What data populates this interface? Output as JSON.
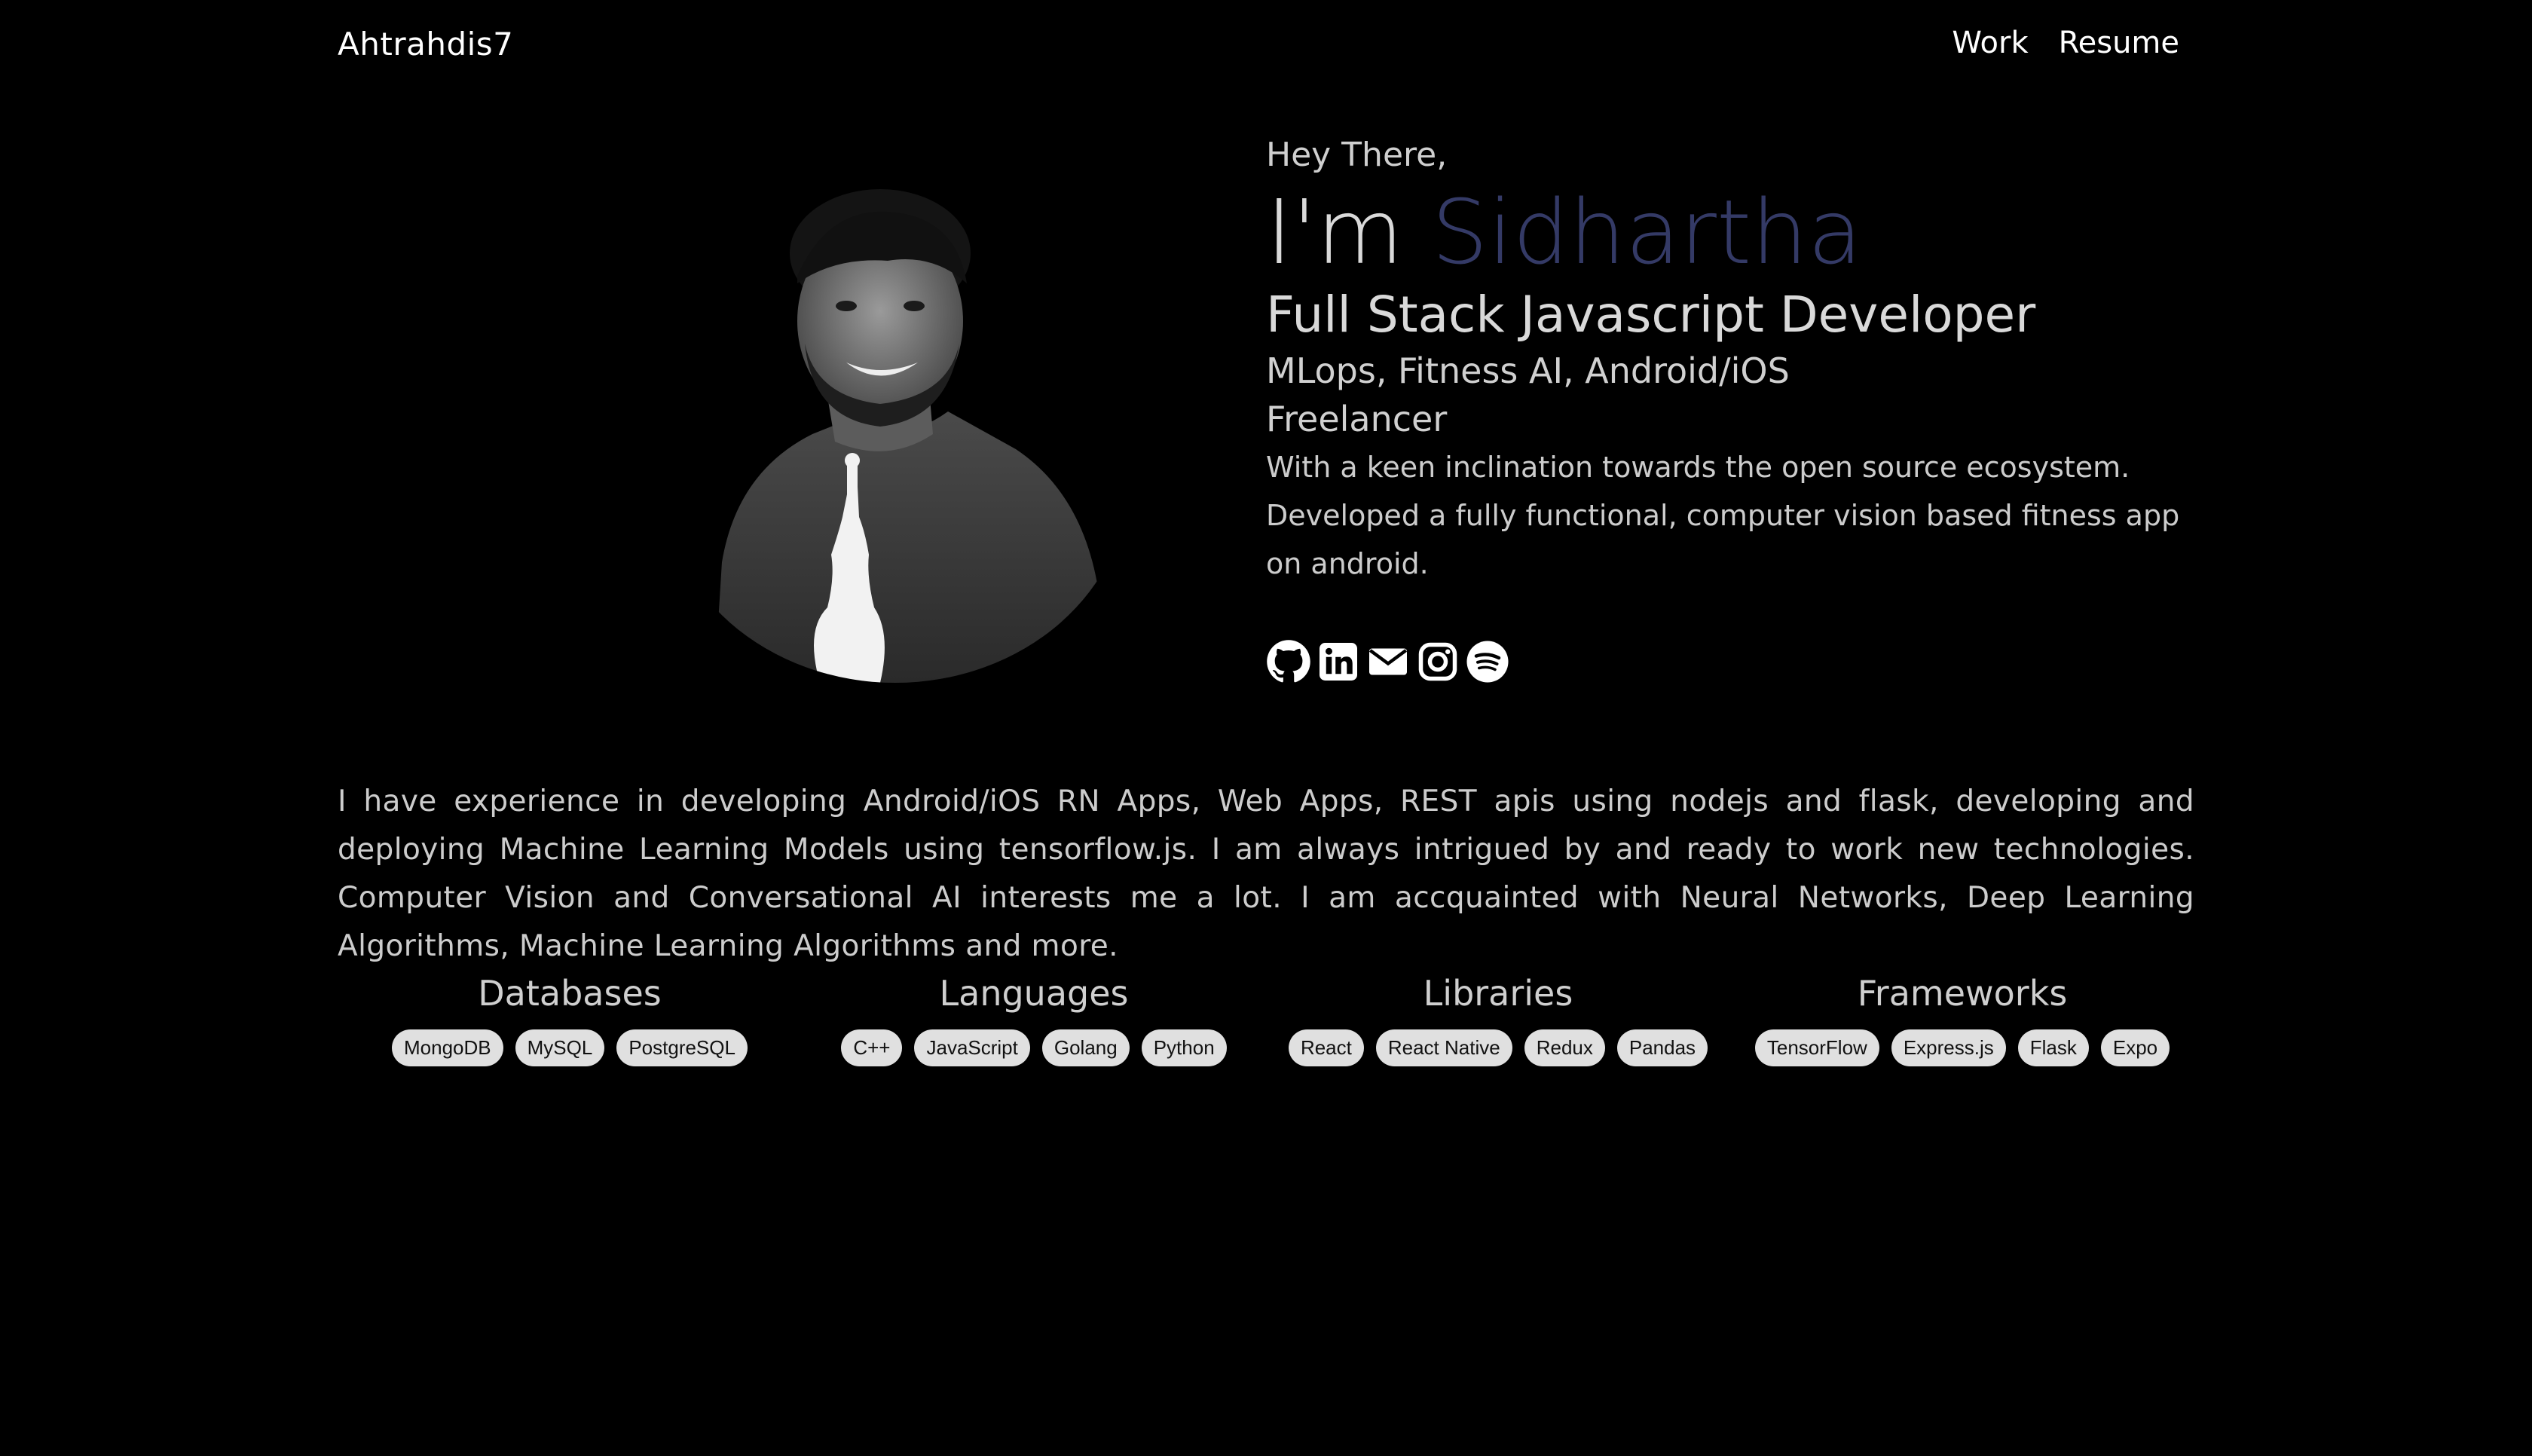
{
  "nav": {
    "brand": "Ahtrahdis7",
    "links": [
      "Work",
      "Resume"
    ]
  },
  "intro": {
    "greeting": "Hey There,",
    "im": "I'm",
    "name": "Sidhartha",
    "role": "Full Stack Javascript Developer",
    "specialties": "MLops, Fitness AI, Android/iOS",
    "status": "Freelancer",
    "description": "With a keen inclination towards the open source ecosystem. Developed a fully functional, computer vision based fitness app on android."
  },
  "socials": [
    "github-icon",
    "linkedin-icon",
    "mail-icon",
    "instagram-icon",
    "spotify-icon"
  ],
  "about": "I have experience in developing Android/iOS RN Apps, Web Apps, REST apis using nodejs and flask, developing and deploying Machine Learning Models using tensorflow.js. I am always intrigued by and ready to work new technologies. Computer Vision and Conversational AI interests me a lot. I am accquainted with Neural Networks, Deep Learning Algorithms, Machine Learning Algorithms and more.",
  "skills": [
    {
      "title": "Databases",
      "tags": [
        "MongoDB",
        "MySQL",
        "PostgreSQL"
      ]
    },
    {
      "title": "Languages",
      "tags": [
        "C++",
        "JavaScript",
        "Golang",
        "Python"
      ]
    },
    {
      "title": "Libraries",
      "tags": [
        "React",
        "React Native",
        "Redux",
        "Pandas"
      ]
    },
    {
      "title": "Frameworks",
      "tags": [
        "TensorFlow",
        "Express.js",
        "Flask",
        "Expo"
      ]
    }
  ],
  "colors": {
    "background": "#000000",
    "accent": "#343a66",
    "tag_bg": "#e0e0e0"
  }
}
